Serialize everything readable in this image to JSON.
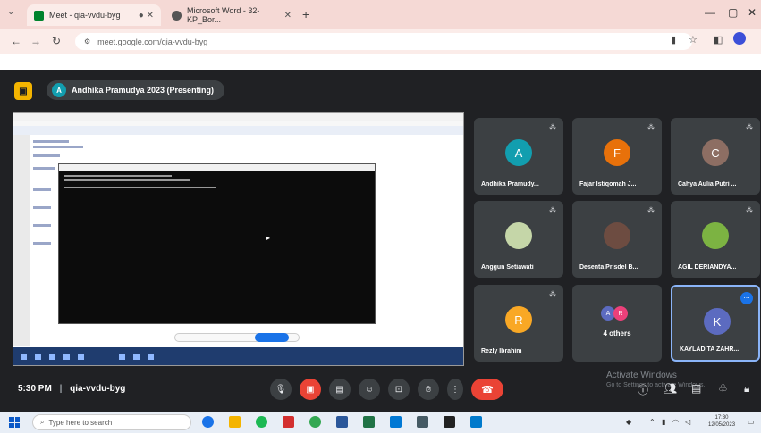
{
  "browser": {
    "tabs": [
      {
        "label": "Meet - qia-vvdu-byg",
        "active": true
      },
      {
        "label": "Microsoft Word - 32-KP_Bor...",
        "active": false
      }
    ],
    "url": "meet.google.com/qia-vvdu-byg"
  },
  "meet": {
    "presenter_initial": "A",
    "presentation_title": "Andhika Pramudya 2023 (Presenting)",
    "time": "5:30 PM",
    "meeting_code": "qia-vvdu-byg",
    "participants": [
      {
        "name": "Andhika Pramudy...",
        "initial": "A",
        "color": "#129eaf"
      },
      {
        "name": "Fajar Istiqomah J...",
        "initial": "F",
        "color": "#e8710a"
      },
      {
        "name": "Cahya Aulia Putri ...",
        "initial": "C",
        "color": "#8d6e63"
      },
      {
        "name": "Anggun Setiawati",
        "initial": "",
        "color": "#c5d6a8"
      },
      {
        "name": "Desenta Prisdel B...",
        "initial": "",
        "color": "#6d4c41"
      },
      {
        "name": "AGIL DERIANDYA...",
        "initial": "",
        "color": "#7cb342"
      },
      {
        "name": "Rezly Ibrahim",
        "initial": "R",
        "color": "#f9a825"
      },
      {
        "name": "KAYLADITA ZAHR...",
        "initial": "K",
        "color": "#5c6bc0"
      }
    ],
    "others": {
      "label": "4 others",
      "initials": [
        "A",
        "R"
      ]
    },
    "activate_windows": "Activate Windows",
    "activate_sub": "Go to Settings to activate Windows."
  },
  "taskbar": {
    "search_placeholder": "Type here to search",
    "clock_time": "17:30",
    "clock_date": "12/05/2023"
  }
}
